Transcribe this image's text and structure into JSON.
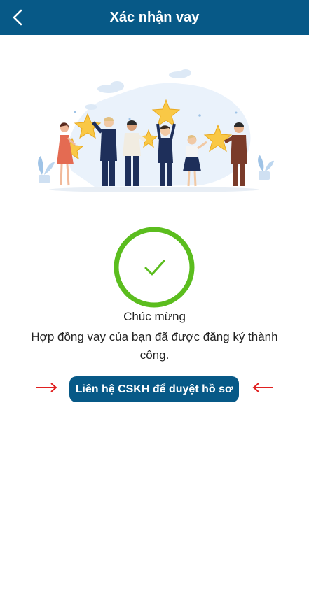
{
  "header": {
    "title": "Xác nhận vay",
    "back_icon": "chevron-left-icon",
    "background": "#075987"
  },
  "status": {
    "icon": "check-circle-icon",
    "ring_color": "#5bbd1e"
  },
  "message": {
    "line1": "Chúc mừng",
    "line2": "Hợp đồng vay của bạn đã được đăng ký thành công."
  },
  "cta": {
    "label": "Liên hệ CSKH để duyệt hồ sơ",
    "background": "#075987"
  },
  "annotations": {
    "arrow_color": "#e02020"
  }
}
